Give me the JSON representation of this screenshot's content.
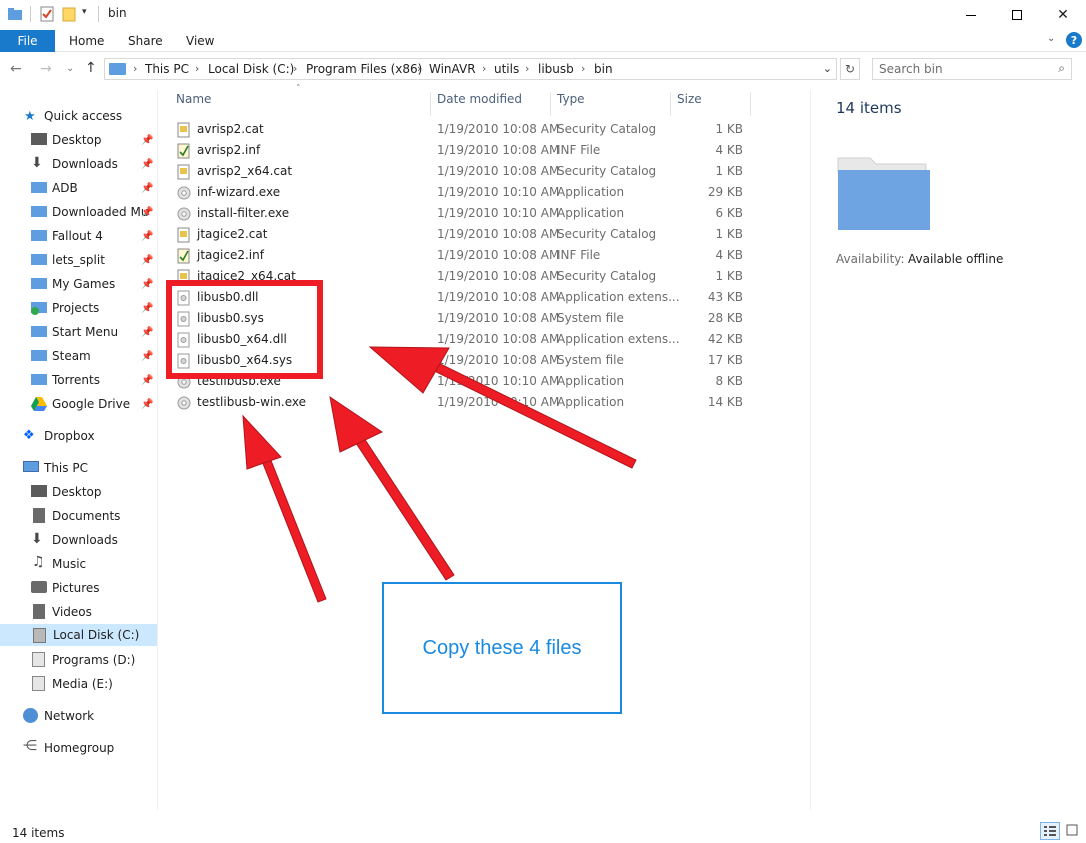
{
  "window": {
    "title": "bin"
  },
  "ribbon": {
    "tabs": [
      "File",
      "Home",
      "Share",
      "View"
    ]
  },
  "address": {
    "crumbs": [
      "This PC",
      "Local Disk (C:)",
      "Program Files (x86)",
      "WinAVR",
      "utils",
      "libusb",
      "bin"
    ]
  },
  "search": {
    "placeholder": "Search bin"
  },
  "sidebar": {
    "quick_access": "Quick access",
    "quick_items": [
      "Desktop",
      "Downloads",
      "ADB",
      "Downloaded Mu",
      "Fallout 4",
      "lets_split",
      "My Games",
      "Projects",
      "Start Menu",
      "Steam",
      "Torrents",
      "Google Drive"
    ],
    "dropbox": "Dropbox",
    "this_pc": "This PC",
    "pc_items": [
      "Desktop",
      "Documents",
      "Downloads",
      "Music",
      "Pictures",
      "Videos",
      "Local Disk (C:)",
      "Programs (D:)",
      "Media (E:)"
    ],
    "network": "Network",
    "homegroup": "Homegroup"
  },
  "columns": {
    "name": "Name",
    "date": "Date modified",
    "type": "Type",
    "size": "Size"
  },
  "files": [
    {
      "name": "avrisp2.cat",
      "date": "1/19/2010 10:08 AM",
      "type": "Security Catalog",
      "size": "1 KB",
      "icon": "catalog-icon"
    },
    {
      "name": "avrisp2.inf",
      "date": "1/19/2010 10:08 AM",
      "type": "INF File",
      "size": "4 KB",
      "icon": "inf-icon"
    },
    {
      "name": "avrisp2_x64.cat",
      "date": "1/19/2010 10:08 AM",
      "type": "Security Catalog",
      "size": "1 KB",
      "icon": "catalog-icon"
    },
    {
      "name": "inf-wizard.exe",
      "date": "1/19/2010 10:10 AM",
      "type": "Application",
      "size": "29 KB",
      "icon": "app-icon"
    },
    {
      "name": "install-filter.exe",
      "date": "1/19/2010 10:10 AM",
      "type": "Application",
      "size": "6 KB",
      "icon": "app-icon"
    },
    {
      "name": "jtagice2.cat",
      "date": "1/19/2010 10:08 AM",
      "type": "Security Catalog",
      "size": "1 KB",
      "icon": "catalog-icon"
    },
    {
      "name": "jtagice2.inf",
      "date": "1/19/2010 10:08 AM",
      "type": "INF File",
      "size": "4 KB",
      "icon": "inf-icon"
    },
    {
      "name": "jtagice2_x64.cat",
      "date": "1/19/2010 10:08 AM",
      "type": "Security Catalog",
      "size": "1 KB",
      "icon": "catalog-icon"
    },
    {
      "name": "libusb0.dll",
      "date": "1/19/2010 10:08 AM",
      "type": "Application extens...",
      "size": "43 KB",
      "icon": "dll-icon"
    },
    {
      "name": "libusb0.sys",
      "date": "1/19/2010 10:08 AM",
      "type": "System file",
      "size": "28 KB",
      "icon": "sys-icon"
    },
    {
      "name": "libusb0_x64.dll",
      "date": "1/19/2010 10:08 AM",
      "type": "Application extens...",
      "size": "42 KB",
      "icon": "dll-icon"
    },
    {
      "name": "libusb0_x64.sys",
      "date": "1/19/2010 10:08 AM",
      "type": "System file",
      "size": "17 KB",
      "icon": "sys-icon"
    },
    {
      "name": "testlibusb.exe",
      "date": "1/19/2010 10:10 AM",
      "type": "Application",
      "size": "8 KB",
      "icon": "app-icon"
    },
    {
      "name": "testlibusb-win.exe",
      "date": "1/19/2010 10:10 AM",
      "type": "Application",
      "size": "14 KB",
      "icon": "app-icon"
    }
  ],
  "details": {
    "count": "14 items",
    "availability_label": "Availability:",
    "availability_value": "Available offline"
  },
  "status": {
    "count": "14 items"
  },
  "annotation": {
    "callout_text": "Copy these 4 files",
    "accent": "#ee1c24",
    "callout_color": "#1a8ae0"
  },
  "colors": {
    "ribbon_file": "#1979ca",
    "folder": "#5d9de0",
    "selected": "#cce8ff"
  }
}
